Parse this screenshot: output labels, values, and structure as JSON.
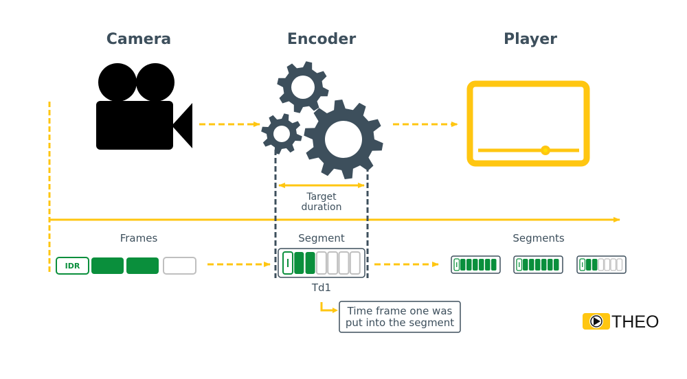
{
  "colors": {
    "accent": "#ffc611",
    "dark": "#3d4f5c",
    "green": "#0a8f3c",
    "grey": "#bfbfbf",
    "black": "#000000"
  },
  "stages": {
    "camera": {
      "title": "Camera",
      "icon": "video-camera-icon"
    },
    "encoder": {
      "title": "Encoder",
      "icon": "gears-icon"
    },
    "player": {
      "title": "Player",
      "icon": "video-player-icon"
    }
  },
  "target_duration": {
    "line1": "Target",
    "line2": "duration"
  },
  "frames": {
    "label": "Frames",
    "items": [
      {
        "type": "idr",
        "text": "IDR"
      },
      {
        "type": "filled"
      },
      {
        "type": "filled"
      },
      {
        "type": "empty"
      }
    ]
  },
  "segment": {
    "label": "Segment",
    "sublabel": "Td1",
    "slots": [
      "idr",
      "filled",
      "filled",
      "empty",
      "empty",
      "empty",
      "empty"
    ]
  },
  "segments": {
    "label": "Segments",
    "items": [
      {
        "filled": 7,
        "total": 7
      },
      {
        "filled": 7,
        "total": 7
      },
      {
        "filled": 3,
        "total": 7
      }
    ]
  },
  "callout": {
    "line1": "Time frame one was",
    "line2": "put into the segment"
  },
  "logo": {
    "text": "THEO",
    "icon": "play-icon"
  }
}
